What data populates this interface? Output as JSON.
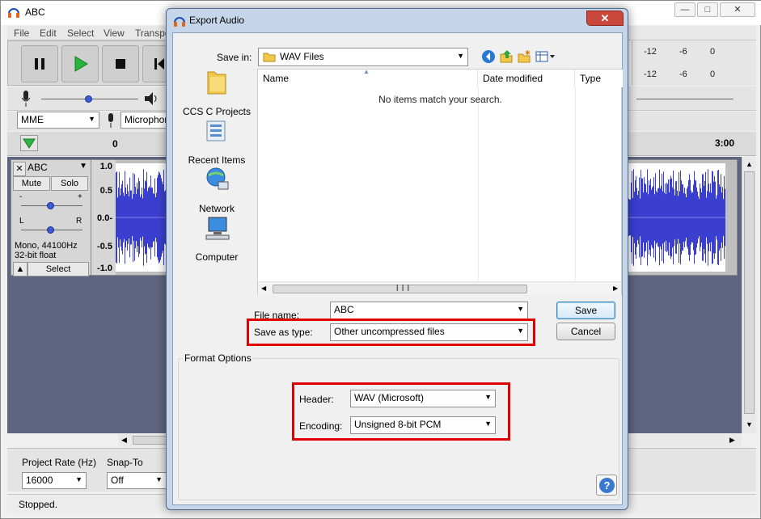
{
  "app": {
    "title": "ABC",
    "menu": [
      "File",
      "Edit",
      "Select",
      "View",
      "Transpo"
    ],
    "meter_labels": [
      "-12",
      "-6",
      "0"
    ],
    "host": "MME",
    "input_device": "Microphon",
    "timeline_labels": [
      "0",
      "3:00"
    ],
    "track": {
      "name": "ABC",
      "mute": "Mute",
      "solo": "Solo",
      "gain_minus": "-",
      "gain_plus": "+",
      "pan_left": "L",
      "pan_right": "R",
      "info_line1": "Mono, 44100Hz",
      "info_line2": "32-bit float",
      "select": "Select",
      "ruler": [
        "1.0",
        "0.5",
        "0.0-",
        "-0.5",
        "-1.0"
      ]
    },
    "project_rate_label": "Project Rate (Hz)",
    "project_rate": "16000",
    "snap_label": "Snap-To",
    "snap_value": "Off",
    "status": "Stopped."
  },
  "dialog": {
    "title": "Export Audio",
    "save_in_label": "Save in:",
    "save_in_value": "WAV Files",
    "places": [
      "CCS C Projects",
      "Recent Items",
      "Network",
      "Computer"
    ],
    "columns": [
      "Name",
      "Date modified",
      "Type"
    ],
    "empty_message": "No items match your search.",
    "file_name_label": "File name:",
    "file_name_value": "ABC",
    "save_type_label": "Save as type:",
    "save_type_value": "Other uncompressed files",
    "save_button": "Save",
    "cancel_button": "Cancel",
    "format_options_label": "Format Options",
    "header_label": "Header:",
    "header_value": "WAV (Microsoft)",
    "encoding_label": "Encoding:",
    "encoding_value": "Unsigned 8-bit PCM",
    "help_symbol": "?"
  },
  "colors": {
    "highlight": "#e00000",
    "waveform": "#3b3fd0",
    "track_bg": "#5f6480"
  }
}
